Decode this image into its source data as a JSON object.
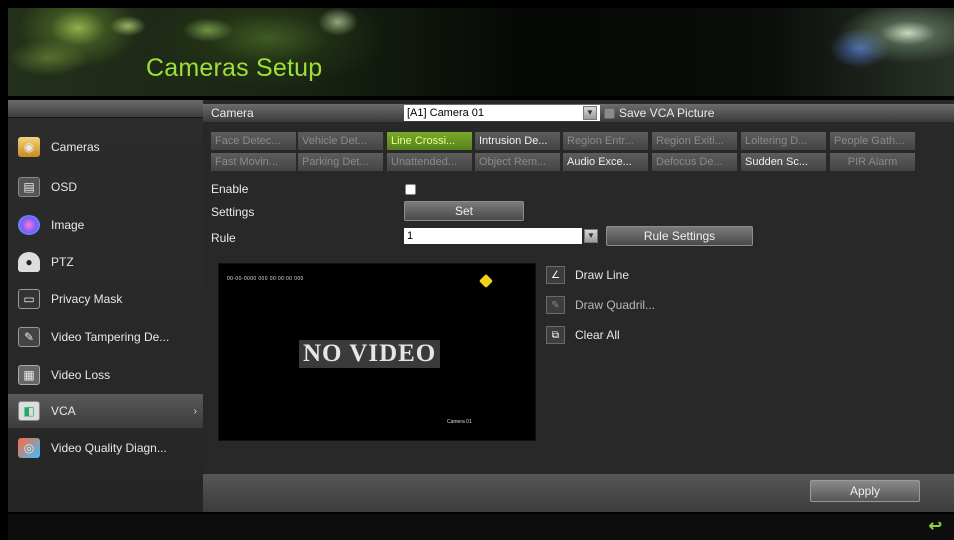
{
  "header": {
    "title": "Cameras Setup"
  },
  "sidebar": {
    "items": [
      {
        "label": "Cameras",
        "icon": "camera-icon"
      },
      {
        "label": "OSD",
        "icon": "osd-icon"
      },
      {
        "label": "Image",
        "icon": "image-icon"
      },
      {
        "label": "PTZ",
        "icon": "ptz-icon"
      },
      {
        "label": "Privacy Mask",
        "icon": "privacy-mask-icon"
      },
      {
        "label": "Video Tampering De...",
        "icon": "tampering-icon"
      },
      {
        "label": "Video Loss",
        "icon": "video-loss-icon"
      },
      {
        "label": "VCA",
        "icon": "vca-icon"
      },
      {
        "label": "Video Quality Diagn...",
        "icon": "quality-icon"
      }
    ]
  },
  "main": {
    "camera_label": "Camera",
    "camera_value": "[A1] Camera 01",
    "save_vca_label": "Save VCA Picture",
    "tabs_row1": [
      "Face Detec...",
      "Vehicle Det...",
      "Line Crossi...",
      "Intrusion De...",
      "Region Entr...",
      "Region Exiti...",
      "Loitering D...",
      "People Gath..."
    ],
    "tabs_row2": [
      "Fast Movin...",
      "Parking Det...",
      "Unattended...",
      "Object Rem...",
      "Audio Exce...",
      "Defocus De...",
      "Sudden Sc...",
      "PIR Alarm"
    ],
    "enable_label": "Enable",
    "settings_label": "Settings",
    "set_button": "Set",
    "rule_label": "Rule",
    "rule_value": "1",
    "rule_settings_button": "Rule Settings",
    "preview": {
      "no_video": "NO VIDEO",
      "osd_datetime": "00-00-0000 000 00:00:00 000",
      "osd_camera": "Camera 01"
    },
    "tools": {
      "draw_line": "Draw Line",
      "draw_quad": "Draw Quadril...",
      "clear_all": "Clear All"
    },
    "apply_button": "Apply"
  },
  "colors": {
    "accent": "#9de03a",
    "selected_tab": "#6a9a24"
  }
}
